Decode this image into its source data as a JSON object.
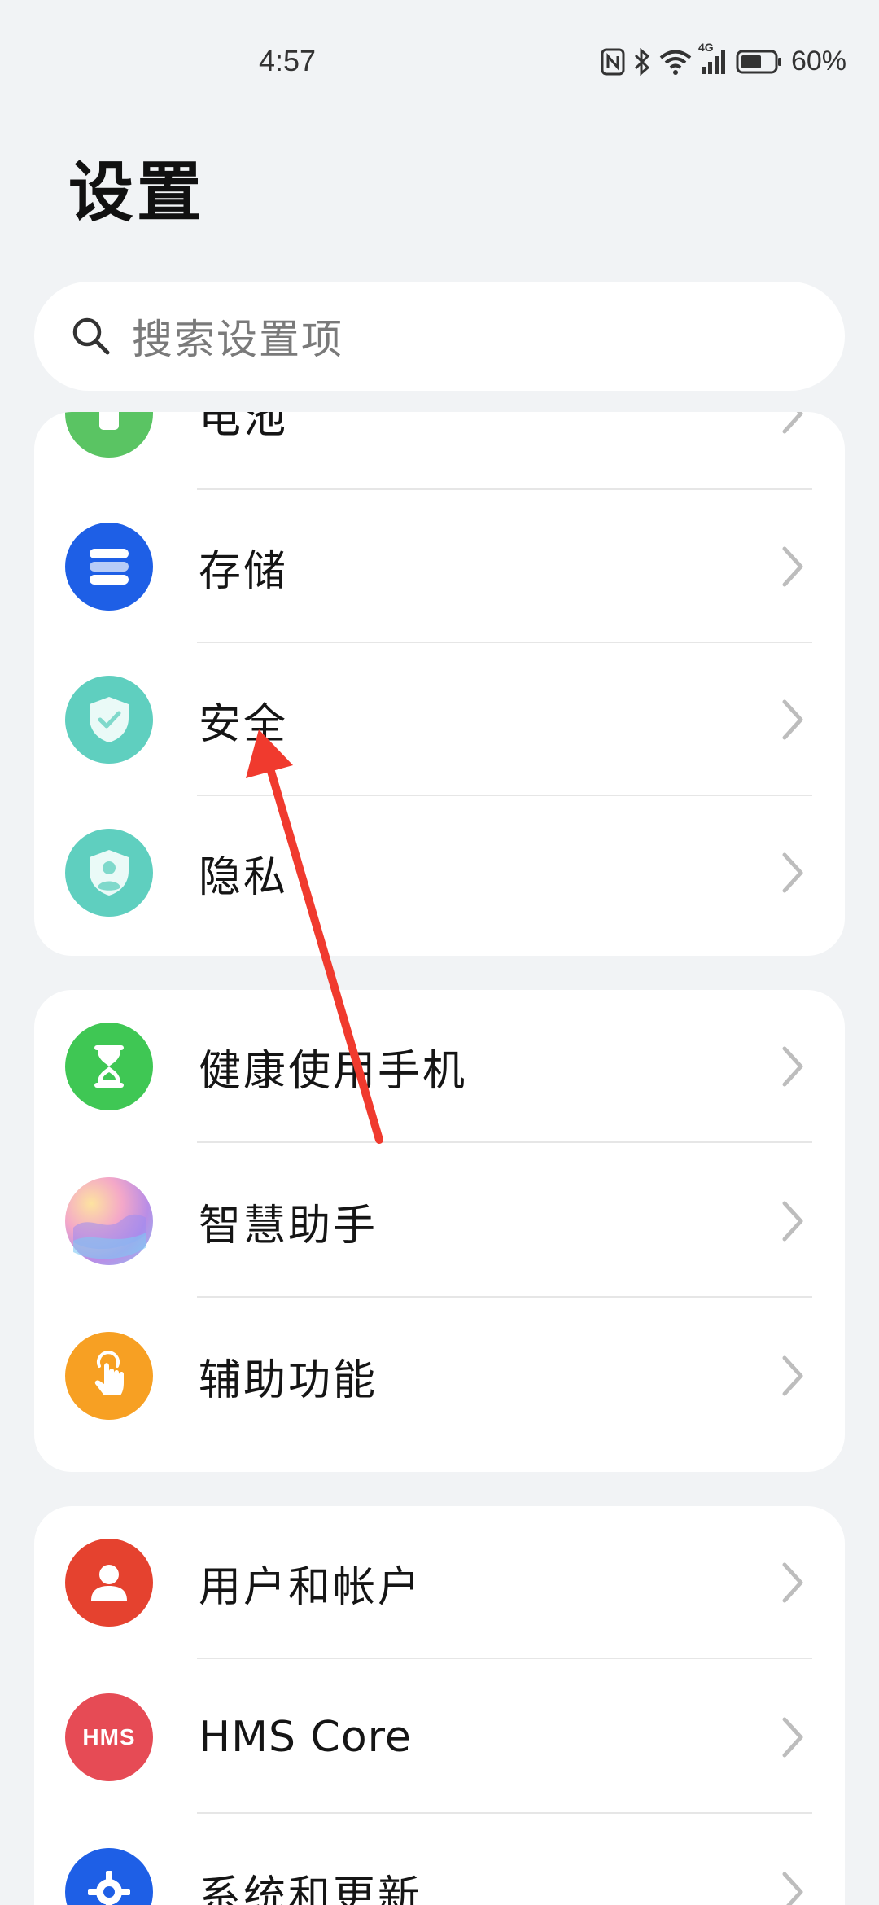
{
  "status": {
    "time": "4:57",
    "battery": "60%",
    "network": "4G"
  },
  "title": "设置",
  "search": {
    "placeholder": "搜索设置项"
  },
  "groups": [
    {
      "items": [
        {
          "label": "电池",
          "icon": "battery-icon",
          "color": "#5ac463"
        },
        {
          "label": "存储",
          "icon": "storage-icon",
          "color": "#1e5fe6"
        },
        {
          "label": "安全",
          "icon": "security-shield-icon",
          "color": "#5fcfbf"
        },
        {
          "label": "隐私",
          "icon": "privacy-shield-icon",
          "color": "#5fcfbf"
        }
      ]
    },
    {
      "items": [
        {
          "label": "健康使用手机",
          "icon": "hourglass-icon",
          "color": "#3fc754"
        },
        {
          "label": "智慧助手",
          "icon": "assistant-icon",
          "color": "#c99ee6"
        },
        {
          "label": "辅助功能",
          "icon": "accessibility-hand-icon",
          "color": "#f7a023"
        }
      ]
    },
    {
      "items": [
        {
          "label": "用户和帐户",
          "icon": "user-icon",
          "color": "#e5422f"
        },
        {
          "label": "HMS Core",
          "icon": "hms-icon",
          "icon_text": "HMS",
          "color": "#e64b55"
        },
        {
          "label": "系统和更新",
          "icon": "gear-icon",
          "color": "#1e5fe6"
        }
      ]
    }
  ],
  "annotation": {
    "color": "#f03a2e"
  }
}
